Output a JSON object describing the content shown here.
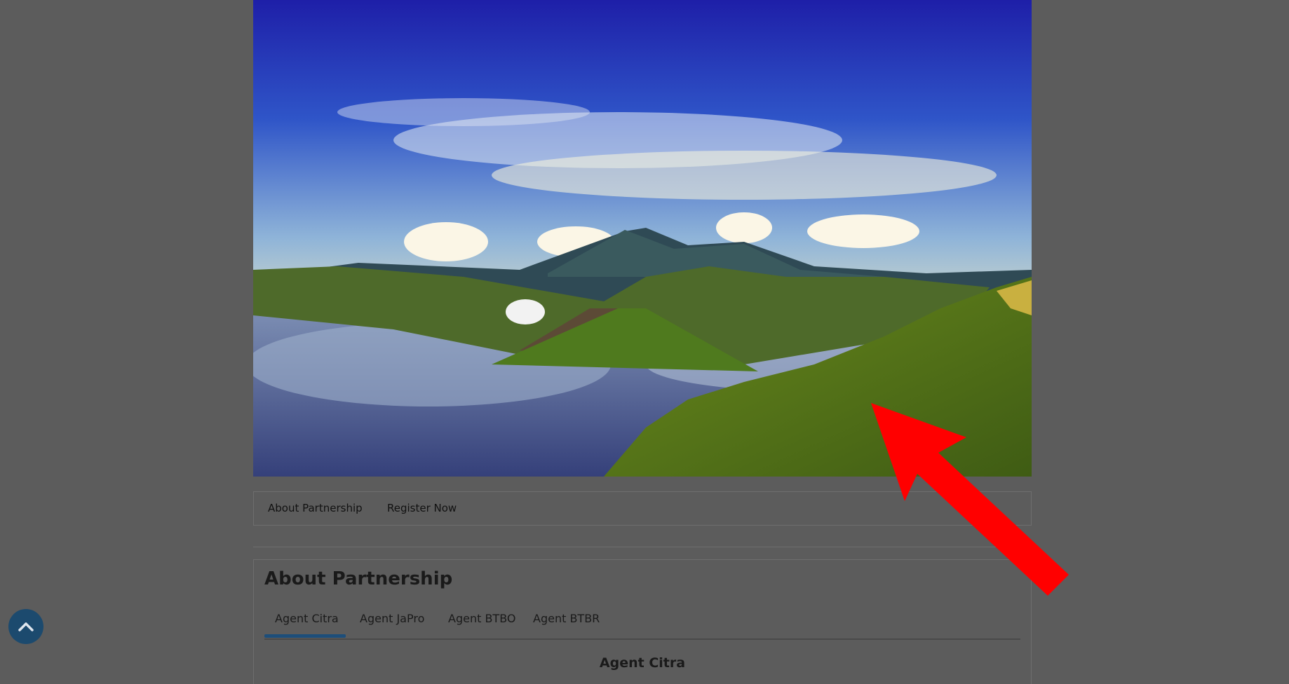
{
  "hero": {
    "image_subject": "landscape-photo"
  },
  "subnav": {
    "items": [
      {
        "label": "About Partnership"
      },
      {
        "label": "Register Now"
      }
    ]
  },
  "section": {
    "title": "About Partnership",
    "tabs": [
      {
        "label": "Agent Citra",
        "active": true
      },
      {
        "label": "Agent JaPro",
        "active": false
      },
      {
        "label": "Agent BTBO",
        "active": false
      },
      {
        "label": "Agent BTBR",
        "active": false
      }
    ],
    "active_tab_heading": "Agent Citra"
  },
  "scroll_top": {
    "icon": "chevron-up-icon"
  },
  "overlay": {
    "arrow_color": "#ff0000",
    "overlay_color": "#5c5c5c",
    "accent_color": "#1d4e7a"
  }
}
